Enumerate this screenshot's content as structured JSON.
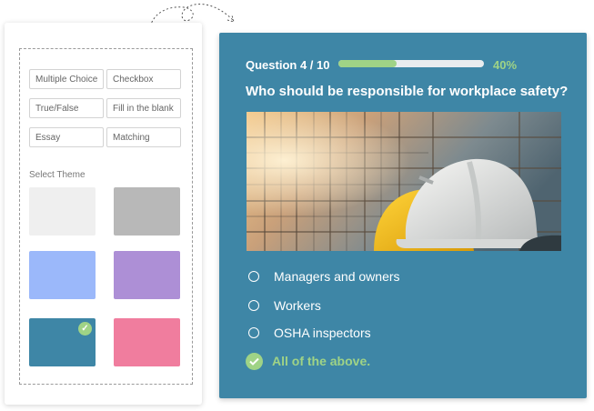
{
  "builder": {
    "question_types": [
      {
        "label": "Multiple Choice"
      },
      {
        "label": "Checkbox"
      },
      {
        "label": "True/False"
      },
      {
        "label": "Fill in the blank"
      },
      {
        "label": "Essay"
      },
      {
        "label": "Matching"
      }
    ],
    "theme_label": "Select Theme",
    "themes": [
      {
        "color": "#efefef",
        "selected": false
      },
      {
        "color": "#b8b8b8",
        "selected": false
      },
      {
        "color": "#9bb8fa",
        "selected": false
      },
      {
        "color": "#ad8fd6",
        "selected": false
      },
      {
        "color": "#3e86a6",
        "selected": true
      },
      {
        "color": "#f07d9e",
        "selected": false
      }
    ]
  },
  "quiz": {
    "counter": "Question 4 / 10",
    "progress": 0.4,
    "progress_label": "40%",
    "question": "Who should be responsible for workplace safety?",
    "options": [
      {
        "label": "Managers and owners",
        "selected": false
      },
      {
        "label": "Workers",
        "selected": false
      },
      {
        "label": "OSHA inspectors",
        "selected": false
      },
      {
        "label": "All of the above.",
        "selected": true
      }
    ]
  },
  "colors": {
    "accent_green": "#9fd386",
    "quiz_bg": "#3e86a6"
  }
}
